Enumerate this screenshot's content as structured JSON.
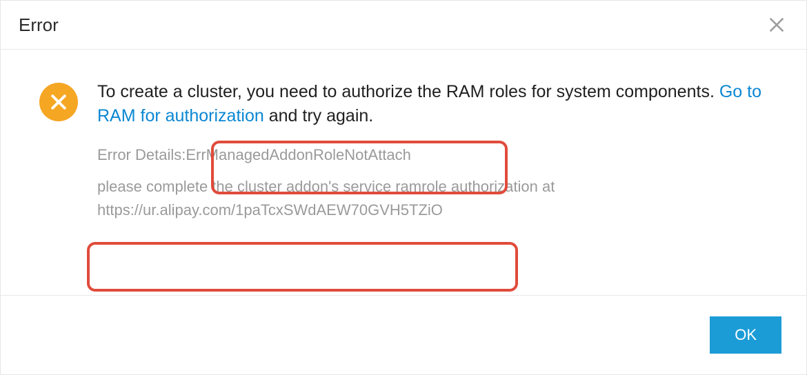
{
  "header": {
    "title": "Error"
  },
  "body": {
    "message_prefix": "To create a cluster, you need to authorize the RAM roles for system components. ",
    "link_label": "Go to RAM for authorization",
    "message_suffix": " and try again.",
    "details_line1": "Error Details:ErrManagedAddonRoleNotAttach",
    "details_line2": "please complete the cluster addon's service ramrole authorization at https://ur.alipay.com/1paTcxSWdAEW70GVH5TZiO"
  },
  "footer": {
    "ok_label": "OK"
  },
  "icons": {
    "status": "error-cross-icon",
    "close": "close-icon"
  }
}
